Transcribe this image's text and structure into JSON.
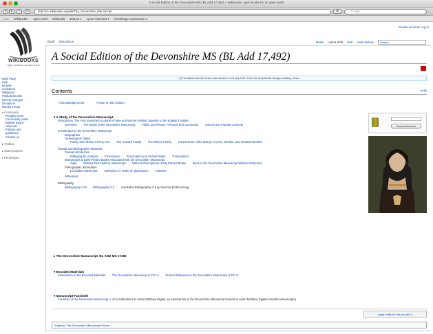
{
  "window": {
    "title": "A Social Edition of the Devonshire MS (BL Add 17,492) – Wikibooks, open books for an open world"
  },
  "browser": {
    "url": "http://en.wikibooks.org/wiki/The_Devonshire_Manuscript",
    "search_placeholder": "Google",
    "bookmarks": [
      "Wikibooks?",
      "open world",
      "Wikipedia",
      "EMLS4 ▾",
      "Lynne Simmons ▾",
      "Knowledge construction ▾"
    ]
  },
  "personal": {
    "links": "Create account  Log in"
  },
  "logo": {
    "text": "WIKIBOOKS",
    "tagline": "Open books for an open world"
  },
  "sidebar": {
    "nav": [
      "Main Page",
      "Help",
      "Browse",
      "Cookbook",
      "Wikijunior",
      "Featured books",
      "Recent changes",
      "Donations",
      "Random book"
    ],
    "community_header": "▾ Community",
    "community": [
      "Reading room",
      "Community portal",
      "Bulletin Board",
      "Help out!",
      "Policies and",
      "guidelines",
      "Contact us"
    ],
    "toolbox": "▸ Toolbox",
    "sister": "▸ Sister projects",
    "print": "▸ Print/export"
  },
  "tabs": {
    "book": "Book",
    "discussion": "Discussion",
    "read": "Read",
    "latest": "Latest draft",
    "edit": "Edit",
    "history": "View history",
    "search_placeholder": "Search"
  },
  "page": {
    "title": "A Social Edition of the Devonshire MS (BL Add 17,492)",
    "notice": "[?] The latest reviewed version was checked on 24 July 2012. There are template/file changes awaiting review."
  },
  "contents": {
    "heading": "Contents",
    "edit": "[edit]",
    "ack": [
      "Acknowledgements",
      "A Note on this Edition"
    ],
    "study_title": "A Study of the Devonshire Manuscript",
    "intro": "Introduction: The First Sustained Example of Men and Women Writing Together in the English Tradition",
    "intro_sub": [
      "Overview",
      "The Works of the Devonshire Manuscript",
      "Public and Private, Personal and Communal",
      "Current and Popular Contexts"
    ],
    "contributors": "Contributors to the Devonshire Manuscript",
    "biographies": "Biographies",
    "genealogical": "Genealogical Tables",
    "gen_sub": [
      "Family and Affairs of Henry VIII",
      "The Howard Family",
      "The Boleyn Family",
      "Connections of the Boleyn, Knyvet, Shelton, and Howard Families"
    ],
    "textual": "Textual and Bibliographic Materials",
    "textual_intro": "Textual Introduction",
    "textual_sub": [
      "Bibliographic Analysis",
      "Provenance",
      "Punctuation and Scribal Marks",
      "Transcription"
    ],
    "manuscripts": "Manuscripts & Early Printed Books Associated with the Devonshire Manuscript",
    "ms_sub": [
      "Sigla",
      "Witness Descriptions, Manuscript",
      "Witness Descriptions, Early Printed Books",
      "Items in the Devonshire Manuscript Without Witnesses"
    ],
    "palaeographic": "Paleographic Information",
    "palaeo_sub": [
      "Detailed Hand Lists",
      "Attribution, In Order of Appearance",
      "Features"
    ],
    "witnesses": "Witnesses",
    "bibliography": "Bibliography",
    "bib_sub": [
      "Bibliography A-M",
      "Bibliography N-Z"
    ],
    "bib_note": "Annotated Bibliography of Key Sources (forthcoming)",
    "manuscript_section": "The Devonshire Manuscript, BL ADD MS 17492",
    "encoded_title": "Encoded Materials",
    "encoded": [
      "Introduction to the Encoded Materials",
      "The Devonshire Manuscript in TEI ☑",
      "Textual Witnesses to the Devonshire Manuscript in TEI ☑"
    ],
    "facsimile_title": "Manuscript Facsimile",
    "facsimile_link": "Facsimile of the Devonshire Manuscript ☑",
    "facsimile_note": "(For subscribers to Adam Matthew Digital, an external link to the Devonshire Manuscript housed at Adam Matthew Digital's Perdita Manuscripts)"
  },
  "shelf": {
    "button": "Search this book"
  },
  "traffic": "page traffic for this month ☑",
  "categories": "Subjects: The Devonshire Manuscript  Poems",
  "colors": {
    "link": "#0645ad",
    "border": "#a7d7f9"
  }
}
